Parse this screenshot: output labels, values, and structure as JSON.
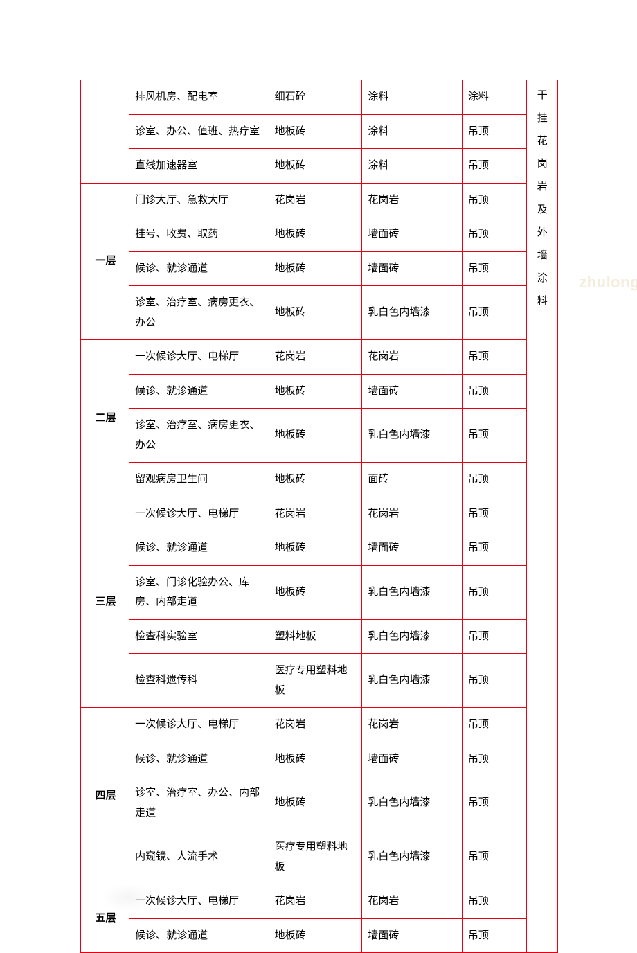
{
  "watermark": "zhulong",
  "side_label": "干挂花岗岩及外墙涂料",
  "groups": [
    {
      "label": "",
      "rows": [
        {
          "c1": "排风机房、配电室",
          "c2": "细石砼",
          "c3": "涂料",
          "c4": "涂料"
        },
        {
          "c1": "诊室、办公、值班、热疗室",
          "c2": "地板砖",
          "c3": "涂料",
          "c4": "吊顶"
        },
        {
          "c1": "直线加速器室",
          "c2": "地板砖",
          "c3": "涂料",
          "c4": "吊顶"
        }
      ]
    },
    {
      "label": "一层",
      "rows": [
        {
          "c1": "门诊大厅、急救大厅",
          "c2": "花岗岩",
          "c3": "花岗岩",
          "c4": "吊顶"
        },
        {
          "c1": "挂号、收费、取药",
          "c2": "地板砖",
          "c3": "墙面砖",
          "c4": "吊顶"
        },
        {
          "c1": "候诊、就诊通道",
          "c2": "地板砖",
          "c3": "墙面砖",
          "c4": "吊顶"
        },
        {
          "c1": "诊室、治疗室、病房更衣、办公",
          "c2": "地板砖",
          "c3": "乳白色内墙漆",
          "c4": "吊顶"
        }
      ]
    },
    {
      "label": "二层",
      "rows": [
        {
          "c1": "一次候诊大厅、电梯厅",
          "c2": "花岗岩",
          "c3": "花岗岩",
          "c4": "吊顶"
        },
        {
          "c1": "候诊、就诊通道",
          "c2": "地板砖",
          "c3": "墙面砖",
          "c4": "吊顶"
        },
        {
          "c1": "诊室、治疗室、病房更衣、办公",
          "c2": "地板砖",
          "c3": "乳白色内墙漆",
          "c4": "吊顶"
        },
        {
          "c1": "留观病房卫生间",
          "c2": "地板砖",
          "c3": "面砖",
          "c4": "吊顶"
        }
      ]
    },
    {
      "label": "三层",
      "rows": [
        {
          "c1": "一次候诊大厅、电梯厅",
          "c2": "花岗岩",
          "c3": "花岗岩",
          "c4": "吊顶"
        },
        {
          "c1": "候诊、就诊通道",
          "c2": "地板砖",
          "c3": "墙面砖",
          "c4": "吊顶"
        },
        {
          "c1": "诊室、门诊化验办公、库房、内部走道",
          "c2": "地板砖",
          "c3": "乳白色内墙漆",
          "c4": "吊顶"
        },
        {
          "c1": "检查科实验室",
          "c2": "塑料地板",
          "c3": "乳白色内墙漆",
          "c4": "吊顶"
        },
        {
          "c1": "检查科遗传科",
          "c2": "医疗专用塑料地板",
          "c3": "乳白色内墙漆",
          "c4": "吊顶"
        }
      ]
    },
    {
      "label": "四层",
      "rows": [
        {
          "c1": "一次候诊大厅、电梯厅",
          "c2": "花岗岩",
          "c3": "花岗岩",
          "c4": "吊顶"
        },
        {
          "c1": "候诊、就诊通道",
          "c2": "地板砖",
          "c3": "墙面砖",
          "c4": "吊顶"
        },
        {
          "c1": "诊室、治疗室、办公、内部走道",
          "c2": "地板砖",
          "c3": "乳白色内墙漆",
          "c4": "吊顶"
        },
        {
          "c1": "内窥镜、人流手术",
          "c2": "医疗专用塑料地板",
          "c3": "乳白色内墙漆",
          "c4": "吊顶"
        }
      ]
    },
    {
      "label": "五层",
      "rows": [
        {
          "c1": "一次候诊大厅、电梯厅",
          "c2": "花岗岩",
          "c3": "花岗岩",
          "c4": "吊顶"
        },
        {
          "c1": "候诊、就诊通道",
          "c2": "地板砖",
          "c3": "墙面砖",
          "c4": "吊顶"
        }
      ]
    }
  ]
}
